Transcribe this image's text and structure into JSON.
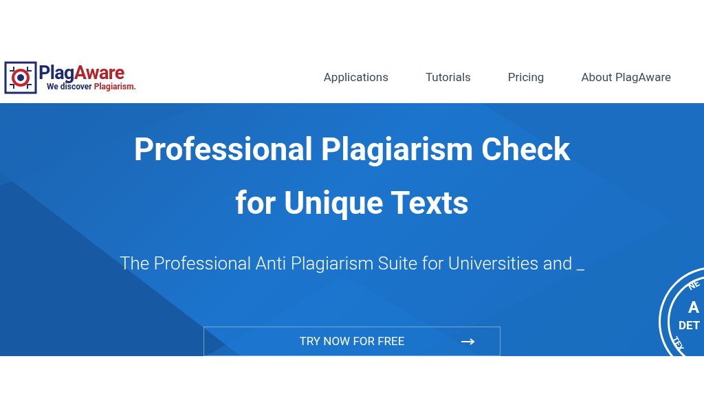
{
  "logo": {
    "name_parts": [
      "Plag",
      "Aware"
    ],
    "tagline_parts": [
      "We discover",
      "Plagiarism."
    ]
  },
  "nav": [
    {
      "label": "Applications"
    },
    {
      "label": "Tutorials"
    },
    {
      "label": "Pricing"
    },
    {
      "label": "About PlagAware"
    }
  ],
  "hero": {
    "title_lines": [
      "Professional Plagiarism Check",
      "for Unique Texts"
    ],
    "subtitle": "The Professional Anti Plagiarism Suite for Universities and _",
    "cta": "TRY NOW FOR FREE",
    "seal": {
      "texts": [
        "NE",
        "A",
        "DET",
        "TEX"
      ]
    }
  }
}
